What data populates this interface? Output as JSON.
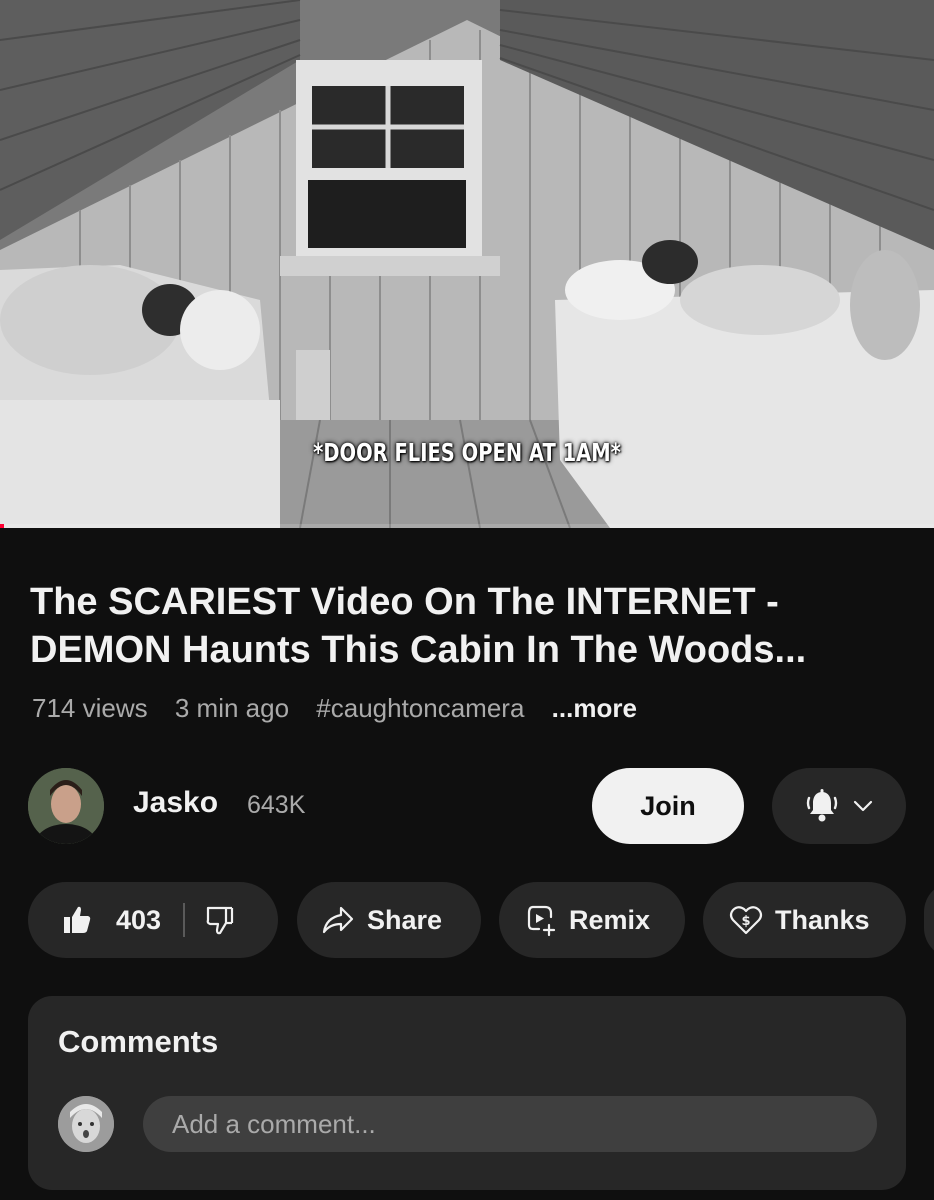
{
  "video": {
    "caption": "*DOOR FLIES OPEN AT 1AM*",
    "progress_fraction": 0.004
  },
  "title": "The SCARIEST Video On The INTERNET - DEMON Haunts This Cabin In The Woods...",
  "meta": {
    "views": "714 views",
    "age": "3 min ago",
    "hashtag": "#caughtoncamera",
    "more": "...more"
  },
  "channel": {
    "name": "Jasko",
    "subscribers": "643K",
    "join_label": "Join",
    "bell_icon": "bell-ringing-icon",
    "chevron_icon": "chevron-down-icon"
  },
  "actions": {
    "likes": "403",
    "share": "Share",
    "remix": "Remix",
    "thanks": "Thanks"
  },
  "comments": {
    "title": "Comments",
    "placeholder": "Add a comment..."
  },
  "colors": {
    "background": "#0f0f0f",
    "surface": "#272727",
    "text_primary": "#f1f1f1",
    "text_secondary": "#aaaaaa",
    "join_bg": "#f1f1f1"
  }
}
